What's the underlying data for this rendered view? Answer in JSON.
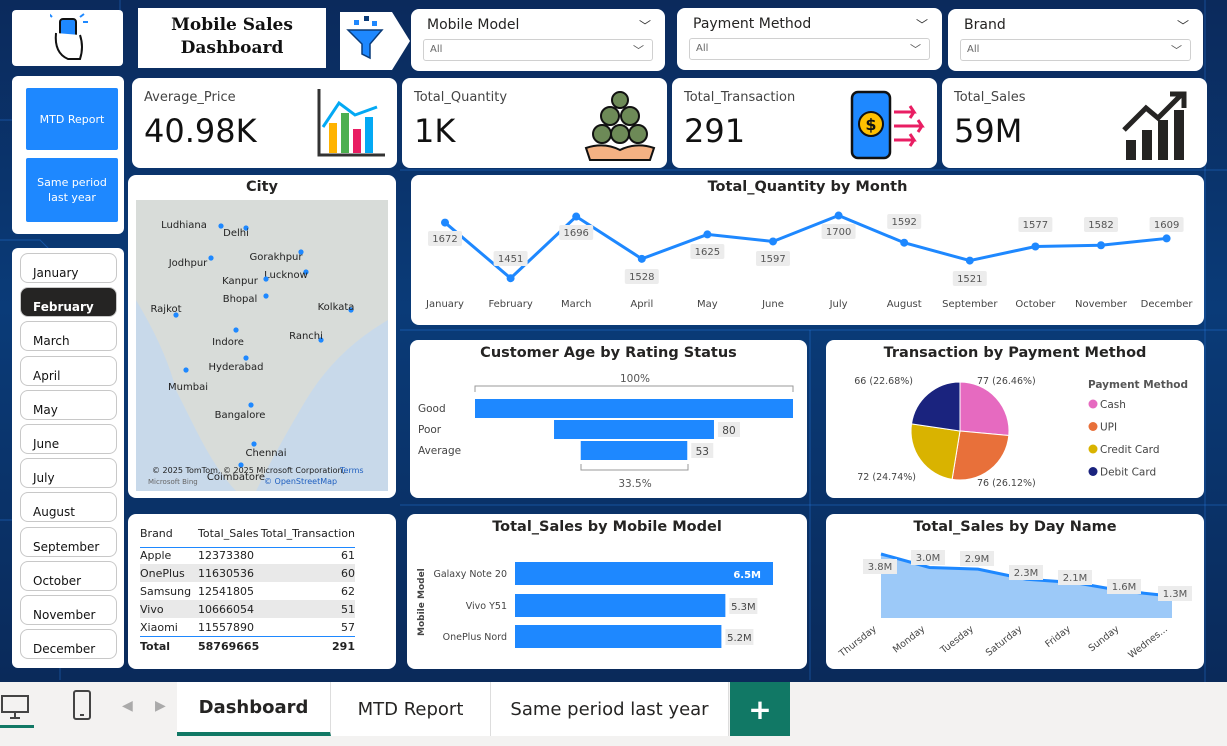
{
  "header": {
    "title_line1": "Mobile Sales",
    "title_line2": "Dashboard"
  },
  "slicers": [
    {
      "label": "Mobile Model",
      "value": "All"
    },
    {
      "label": "Payment Method",
      "value": "All"
    },
    {
      "label": "Brand",
      "value": "All"
    }
  ],
  "kpis": [
    {
      "label": "Average_Price",
      "value": "40.98K"
    },
    {
      "label": "Total_Quantity",
      "value": "1K"
    },
    {
      "label": "Total_Transaction",
      "value": "291"
    },
    {
      "label": "Total_Sales",
      "value": "59M"
    }
  ],
  "nav": {
    "mtd": "MTD Report",
    "same_period": "Same period last year"
  },
  "months": [
    "January",
    "February",
    "March",
    "April",
    "May",
    "June",
    "July",
    "August",
    "September",
    "October",
    "November",
    "December"
  ],
  "selected_month": "February",
  "map": {
    "title": "City",
    "cities": [
      "Ludhiana",
      "Delhi",
      "Jodhpur",
      "Gorakhpur",
      "Lucknow",
      "Kanpur",
      "Bhopal",
      "Kolkata",
      "Rajkot",
      "Indore",
      "Ranchi",
      "Hyderabad",
      "Mumbai",
      "Bangalore",
      "Chennai",
      "Coimbatore"
    ],
    "copyright": "© 2025 TomTom, © 2025 Microsoft Corporation,",
    "terms": "Terms",
    "osm": "© OpenStreetMap",
    "bing": "Microsoft Bing"
  },
  "table": {
    "headers": [
      "Brand",
      "Total_Sales",
      "Total_Transaction"
    ],
    "rows": [
      [
        "Apple",
        "12373380",
        "61"
      ],
      [
        "OnePlus",
        "11630536",
        "60"
      ],
      [
        "Samsung",
        "12541805",
        "62"
      ],
      [
        "Vivo",
        "10666054",
        "51"
      ],
      [
        "Xiaomi",
        "11557890",
        "57"
      ]
    ],
    "total": [
      "Total",
      "58769665",
      "291"
    ]
  },
  "charts": {
    "quantity": {
      "title": "Total_Quantity by Month",
      "chart_data": {
        "type": "line",
        "categories": [
          "January",
          "February",
          "March",
          "April",
          "May",
          "June",
          "July",
          "August",
          "September",
          "October",
          "November",
          "December"
        ],
        "values": [
          1672,
          1451,
          1696,
          1528,
          1625,
          1597,
          1700,
          1592,
          1521,
          1577,
          1582,
          1609
        ]
      }
    },
    "age": {
      "title": "Customer Age by Rating Status",
      "top_label": "100%",
      "bottom_label": "33.5%",
      "chart_data": {
        "type": "bar",
        "categories": [
          "Good",
          "Poor",
          "Average"
        ],
        "values": [
          null,
          80,
          53
        ],
        "value_labels": [
          "",
          "80",
          "53"
        ],
        "widths_percent": [
          100,
          50.3,
          33.5
        ]
      }
    },
    "payment": {
      "title": "Transaction by Payment Method",
      "legend_title": "Payment Method",
      "chart_data": {
        "type": "pie",
        "labels": [
          "Cash",
          "UPI",
          "Credit Card",
          "Debit Card"
        ],
        "values": [
          77,
          76,
          72,
          66
        ],
        "value_labels": [
          "77 (26.46%)",
          "76 (26.12%)",
          "72 (24.74%)",
          "66 (22.68%)"
        ],
        "colors": [
          "#e66ac0",
          "#e8703a",
          "#d9b300",
          "#1a237e"
        ]
      }
    },
    "model": {
      "title": "Total_Sales by Mobile Model",
      "ylabel": "Mobile Model",
      "chart_data": {
        "type": "bar",
        "categories": [
          "Galaxy Note 20",
          "Vivo Y51",
          "OnePlus Nord"
        ],
        "values": [
          6.5,
          5.3,
          5.2
        ],
        "value_labels": [
          "6.5M",
          "5.3M",
          "5.2M"
        ]
      }
    },
    "day": {
      "title": "Total_Sales by Day Name",
      "chart_data": {
        "type": "area",
        "categories": [
          "Thursday",
          "Monday",
          "Tuesday",
          "Saturday",
          "Friday",
          "Sunday",
          "Wednes..."
        ],
        "values": [
          3.8,
          3.0,
          2.9,
          2.3,
          2.1,
          1.6,
          1.3
        ],
        "value_labels": [
          "3.8M",
          "3.0M",
          "2.9M",
          "2.3M",
          "2.1M",
          "1.6M",
          "1.3M"
        ]
      }
    }
  },
  "tabs": [
    "Dashboard",
    "MTD Report",
    "Same period last year"
  ],
  "add_tab": "+",
  "colors": {
    "accent": "#1e88ff",
    "dark": "#252423",
    "teal": "#117865"
  }
}
